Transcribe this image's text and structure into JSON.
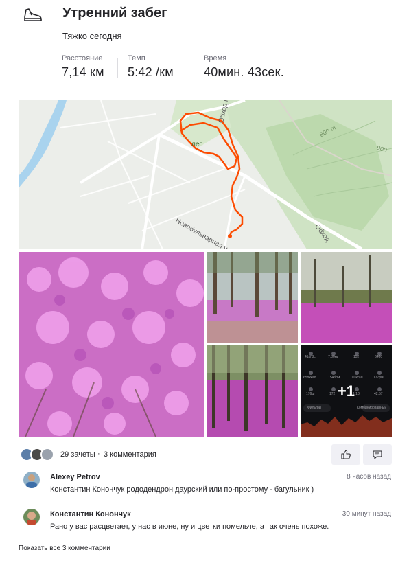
{
  "activity": {
    "title": "Утренний забег",
    "description": "Тяжко сегодня",
    "icon": "running-shoe-icon"
  },
  "stats": [
    {
      "label": "Расстояние",
      "value": "7,14 км"
    },
    {
      "label": "Темп",
      "value": "5:42 /км"
    },
    {
      "label": "Время",
      "value": "40мин. 43сек."
    }
  ],
  "map": {
    "labels": {
      "forest": "лес",
      "road_bypass_top": "Обход г. Чита",
      "road_bypass_bottom": "Обход",
      "street": "Новобульварная у",
      "elevation_1": "800 m",
      "elevation_2": "900"
    },
    "route_color": "#fc4c02"
  },
  "photos": {
    "more_count": "+1",
    "watch_stats": [
      "41м 8с",
      "7,30км",
      "152",
      "6480",
      "658ккал",
      "154бпм",
      "101ккал",
      "177рм",
      "176ш",
      "172",
      "1,18",
      "42,57"
    ],
    "watch_toggle_left": "Фильтры",
    "watch_toggle_right": "Комбинированный"
  },
  "social": {
    "kudos": "29 зачеты",
    "separator": "·",
    "comments": "3 комментария"
  },
  "comments": [
    {
      "author": "Alexey Petrov",
      "time": "8 часов назад",
      "text": "Константин Конончук рододендрон даурский или по-простому - багульник )"
    },
    {
      "author": "Константин Конончук",
      "time": "30 минут назад",
      "text": "Рано у вас расцветает, у нас в июне, ну и цветки помельче, а так очень похоже."
    }
  ],
  "show_all": "Показать все 3 комментарии",
  "colors": {
    "accent": "#fc4c02",
    "text": "#242428",
    "muted": "#6d6d78",
    "button_bg": "#f0f0f5"
  }
}
